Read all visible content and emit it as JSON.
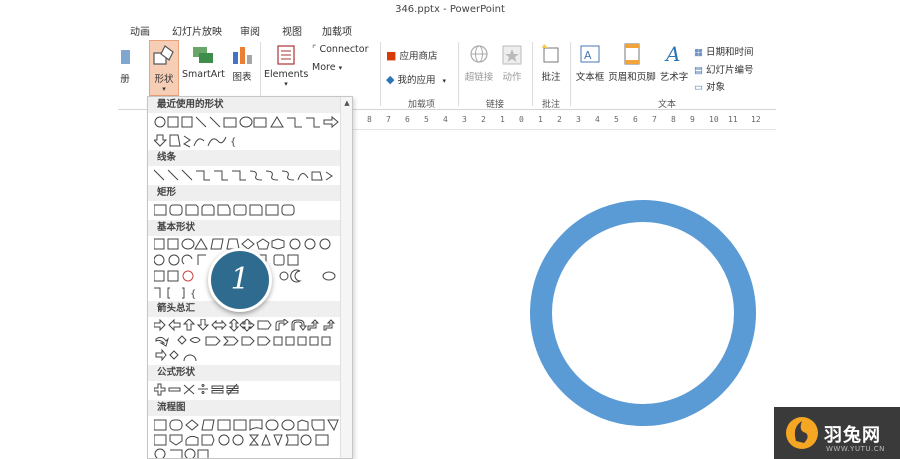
{
  "window": {
    "title": "346.pptx - PowerPoint"
  },
  "menu": [
    "动画",
    "幻灯片放映",
    "审阅",
    "视图",
    "加载项"
  ],
  "ribbon": {
    "partial_label": "册",
    "shapes_label": "形状",
    "smartart_label": "SmartArt",
    "chart_label": "图表",
    "elements_label": "Elements",
    "connector_label": "Connector",
    "more_label": "More",
    "app_store_label": "应用商店",
    "my_apps_label": "我的应用",
    "addins_group": "加载项",
    "hyperlink_label": "超链接",
    "action_label": "动作",
    "links_group": "链接",
    "comment_label": "批注",
    "comments_group": "批注",
    "textbox_label": "文本框",
    "header_footer_label": "页眉和页脚",
    "wordart_label": "艺术字",
    "date_time_label": "日期和时间",
    "slide_number_label": "幻灯片编号",
    "object_label": "对象",
    "text_group": "文本"
  },
  "gallery": {
    "categories": [
      "最近使用的形状",
      "线条",
      "矩形",
      "基本形状",
      "箭头总汇",
      "公式形状",
      "流程图"
    ],
    "scroll_up": "▲"
  },
  "ruler": {
    "ticks": [
      "8",
      "7",
      "6",
      "5",
      "4",
      "3",
      "2",
      "1",
      "0",
      "1",
      "2",
      "3",
      "4",
      "5",
      "6",
      "7",
      "8",
      "9",
      "10",
      "11",
      "12"
    ]
  },
  "slide": {
    "ring_color": "#5b9bd5"
  },
  "callout": {
    "number": "1"
  },
  "watermark": {
    "brand": "羽兔网",
    "url": "WWW.YUTU.CN"
  }
}
